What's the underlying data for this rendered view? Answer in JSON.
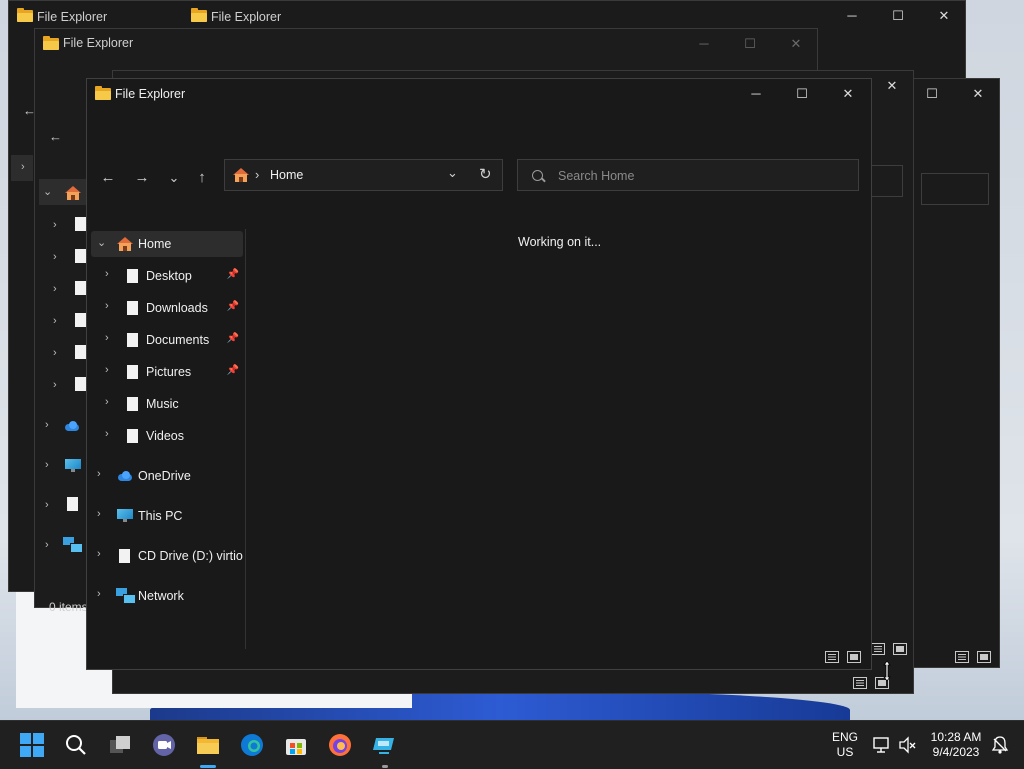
{
  "app_title": "File Explorer",
  "window": {
    "title": "File Explorer",
    "minimize_glyph": "─",
    "maximize_glyph": "☐",
    "close_glyph": "✕"
  },
  "toolbar": {
    "back_glyph": "←",
    "forward_glyph": "→",
    "recent_glyph": "⌄",
    "up_glyph": "↑",
    "breadcrumb_sep": "›",
    "address": "Home",
    "dropdown_glyph": "⌄",
    "refresh_glyph": "↻",
    "search_placeholder": "Search Home"
  },
  "sidebar": {
    "items": [
      {
        "label": "Home",
        "icon": "home-icon",
        "selected": true,
        "pinned": false
      },
      {
        "label": "Desktop",
        "icon": "document-icon",
        "pinned": true
      },
      {
        "label": "Downloads",
        "icon": "document-icon",
        "pinned": true
      },
      {
        "label": "Documents",
        "icon": "document-icon",
        "pinned": true
      },
      {
        "label": "Pictures",
        "icon": "document-icon",
        "pinned": true
      },
      {
        "label": "Music",
        "icon": "document-icon",
        "pinned": false
      },
      {
        "label": "Videos",
        "icon": "document-icon",
        "pinned": false
      },
      {
        "label": "OneDrive",
        "icon": "onedrive-icon"
      },
      {
        "label": "This PC",
        "icon": "this-pc-icon"
      },
      {
        "label": "CD Drive (D:) virtio-w",
        "icon": "cd-drive-icon"
      },
      {
        "label": "Network",
        "icon": "network-icon"
      }
    ],
    "pin_glyph": "📌",
    "expand_glyph": "›",
    "collapse_glyph": "⌄"
  },
  "content": {
    "status_message": "Working on it..."
  },
  "background_windows": {
    "title": "File Explorer",
    "status_text": "0 items"
  },
  "taskbar": {
    "language": "ENG",
    "region": "US",
    "time": "10:28 AM",
    "date": "9/4/2023"
  },
  "colors": {
    "accent": "#3fa9f5",
    "window_bg": "#191919",
    "taskbar_bg": "#202020"
  }
}
